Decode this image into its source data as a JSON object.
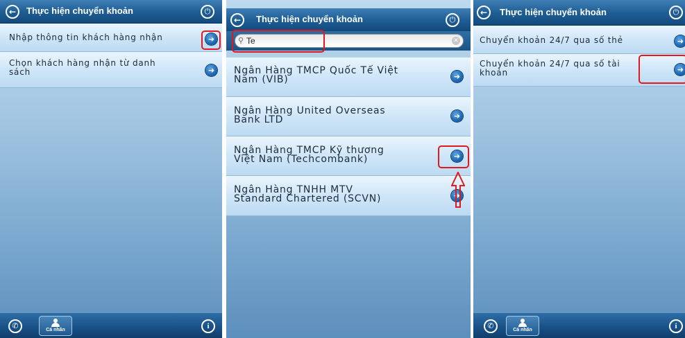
{
  "panel1": {
    "title": "Thực hiện chuyển khoản",
    "rows": [
      {
        "label": "Nhập thông tin khách hàng nhận"
      },
      {
        "label": "Chọn khách hàng nhận từ danh\nsách"
      }
    ],
    "footer": {
      "profile_label": "Cá nhân"
    }
  },
  "panel2": {
    "title": "Thực hiện chuyển khoản",
    "search": {
      "value": "Te"
    },
    "rows": [
      {
        "label": "Ngân Hàng TMCP Quốc Tế Việt\nNam (VIB)"
      },
      {
        "label": "Ngân Hàng United Overseas\nBank LTD"
      },
      {
        "label": "Ngân Hàng TMCP Kỹ thương\nViệt Nam (Techcombank)"
      },
      {
        "label": "Ngân Hàng TNHH MTV\nStandard Chartered (SCVN)"
      }
    ]
  },
  "panel3": {
    "title": "Thực hiện chuyển khoản",
    "rows": [
      {
        "label": "Chuyển khoản 24/7 qua số thẻ"
      },
      {
        "label": "Chuyển khoản 24/7 qua số tài\nkhoản"
      }
    ],
    "footer": {
      "profile_label": "Cá nhân"
    }
  },
  "icons": {
    "back": "back-arrow-icon",
    "power": "power-icon",
    "arrow": "arrow-right-icon",
    "phone": "phone-icon",
    "profile": "person-icon",
    "info": "info-icon",
    "search": "search-icon",
    "clear": "clear-icon"
  },
  "colors": {
    "header": "#1f5f96",
    "row": "#cfe6f8",
    "arrow": "#1e69b4",
    "highlight": "#e0191f"
  }
}
